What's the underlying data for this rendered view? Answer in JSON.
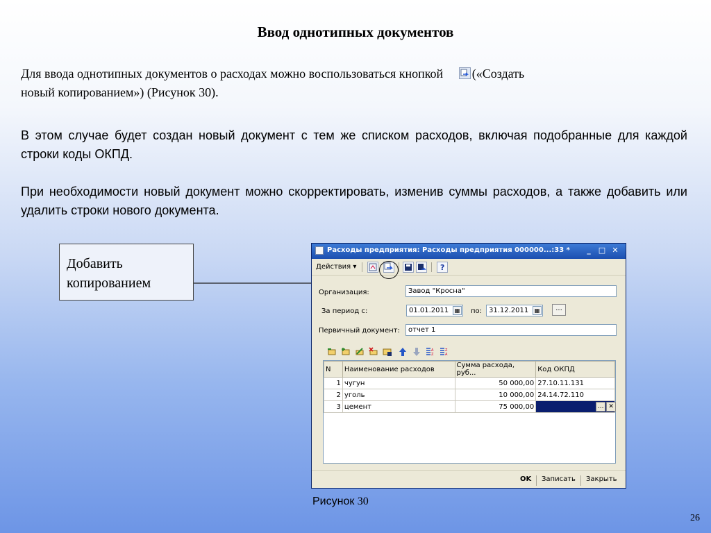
{
  "slide": {
    "title": "Ввод однотипных документов",
    "intro_line1_a": "Для ввода однотипных документов о расходах можно воспользоваться кнопкой",
    "intro_line1_b": "(«Создать",
    "intro_line2": "новый копированием»)   (Рисунок 30).",
    "para1": "В этом случае будет создан новый документ с тем же списком расходов, включая подобранные для каждой строки коды ОКПД.",
    "para2": "При необходимости новый документ можно скорректировать, изменив суммы расходов, а также добавить или удалить строки нового документа.",
    "callout_line1": "Добавить",
    "callout_line2": "копированием",
    "caption_word": "Рисунок",
    "caption_num": "30",
    "page_number": "26"
  },
  "window": {
    "title": "Расходы предприятия: Расходы предприятия 000000...:33 *",
    "min_glyph": "_",
    "max_glyph": "□",
    "close_glyph": "✕",
    "actions_menu": "Действия ▾",
    "organization_label": "Организация:",
    "organization_value": "Завод \"Кросна\"",
    "period_label": "За период с:",
    "period_from": "01.01.2011",
    "period_to_label": "по:",
    "period_to": "31.12.2011",
    "ellipsis": "...",
    "primary_doc_label": "Первичный документ:",
    "primary_doc_value": "отчет 1",
    "columns": [
      "N",
      "Наименование расходов",
      "Сумма расхода, руб...",
      "Код ОКПД"
    ],
    "rows": [
      {
        "n": "1",
        "name": "чугун",
        "sum": "50 000,00",
        "code": "27.10.11.131"
      },
      {
        "n": "2",
        "name": "уголь",
        "sum": "10 000,00",
        "code": "24.14.72.110"
      },
      {
        "n": "3",
        "name": "цемент",
        "sum": "75 000,00",
        "code": ""
      }
    ],
    "cell_select_glyph": "...",
    "cell_clear_glyph": "✕",
    "ok_label": "OK",
    "save_label": "Записать",
    "close_label": "Закрыть"
  },
  "colors": {
    "titlebar": "#1c4fb0",
    "editing_cell": "#0a1e6e",
    "window_bg": "#ece9d8"
  }
}
